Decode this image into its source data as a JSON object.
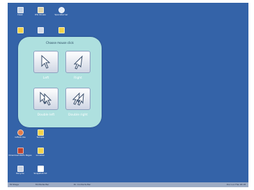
{
  "desktop": {
    "background": "#3463a8",
    "icons": [
      {
        "label": "Desk",
        "icon": "monitor-icon",
        "color": "#c4d2e4"
      },
      {
        "label": "IPG Shows",
        "icon": "gallery-icon",
        "color": "#e0d4a8"
      },
      {
        "label": "Spaceburner",
        "icon": "moon-icon",
        "color": "#e6eef7"
      },
      {
        "label": "",
        "icon": "folder-icon",
        "color": "#f4d24a"
      },
      {
        "label": "",
        "icon": "app-icon",
        "color": "#d3dae6"
      },
      {
        "label": "",
        "icon": "folder-icon",
        "color": "#f4d24a"
      },
      {
        "label": "GPSAt.nte",
        "icon": "globe-icon",
        "color": "#e37d4a"
      },
      {
        "label": "Temple",
        "icon": "folder-icon",
        "color": "#f4d24a"
      },
      {
        "label": "Download PDFs Pages",
        "icon": "download-icon",
        "color": "#c0452f"
      },
      {
        "label": "Location",
        "icon": "folder-icon",
        "color": "#f4d24a"
      },
      {
        "label": "Recycle",
        "icon": "recycle-icon",
        "color": "#c9d3e3"
      },
      {
        "label": "Snapshot.txt",
        "icon": "document-icon",
        "color": "#ffffff"
      }
    ]
  },
  "mouse_panel": {
    "title": "Choose mouse click",
    "background": "#aee0df",
    "buttons": [
      {
        "label": "Left",
        "icon": "cursor-arrow-icon"
      },
      {
        "label": "Right",
        "icon": "cursor-arrow-right-icon"
      },
      {
        "label": "Double left",
        "icon": "double-cursor-icon"
      },
      {
        "label": "Double right",
        "icon": "double-cursor-right-icon"
      }
    ]
  },
  "taskbar": {
    "items": [
      "Mi Stage",
      "Mi Media Bar",
      "Dr. Contacts Bar"
    ],
    "tray_text": "Doc Loc File 18:18"
  }
}
